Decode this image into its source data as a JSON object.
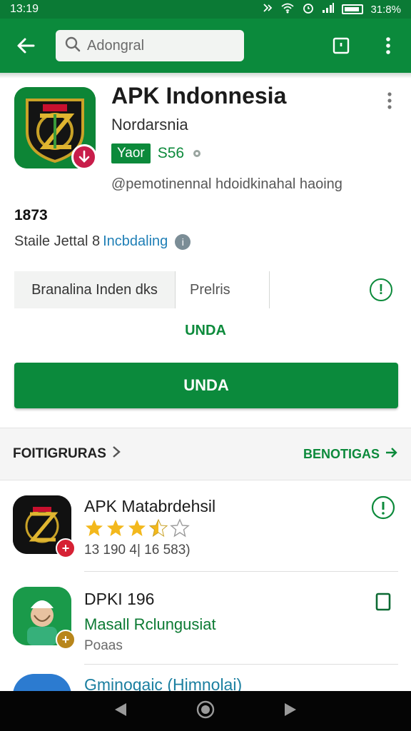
{
  "status_bar": {
    "time": "13:19",
    "battery": "31:8%"
  },
  "search": {
    "placeholder": "Adongral"
  },
  "app": {
    "title": "APK Indonnesia",
    "developer": "Nordarsnia",
    "tag": "Yaor",
    "tag_count": "S56",
    "handle": "@pemotinennal hdoidkinahal haoing",
    "number": "1873",
    "status_text": "Staile Jettal 8",
    "status_link": "Incbdaling",
    "status_info_icon": "info-icon"
  },
  "segments": {
    "left": "Branalina Inden dks",
    "middle": "Prelris"
  },
  "green_link": "UNDA",
  "primary_button": "UNDA",
  "section": {
    "left_label": "FOITIGRURAS",
    "right_label": "BENOTIGAS"
  },
  "list": [
    {
      "title": "APK Matabrdehsil",
      "meta": "13 190 4| 16 583)",
      "rating": 3.5,
      "badge_color": "#d62134",
      "badge": "+"
    },
    {
      "title": "DPKI 196",
      "sub": "Masall Rclungusiat",
      "meta": "Poaas",
      "badge_color": "#b8861b",
      "badge": "+"
    }
  ],
  "partial_item": {
    "title": "Gminogaic (Himnolai)"
  },
  "colors": {
    "brand_green": "#0b8a3c",
    "status_green": "#0b7a35",
    "badge_red": "#c81d4a",
    "star": "#f3b81c",
    "link_blue": "#1f7fb6"
  }
}
